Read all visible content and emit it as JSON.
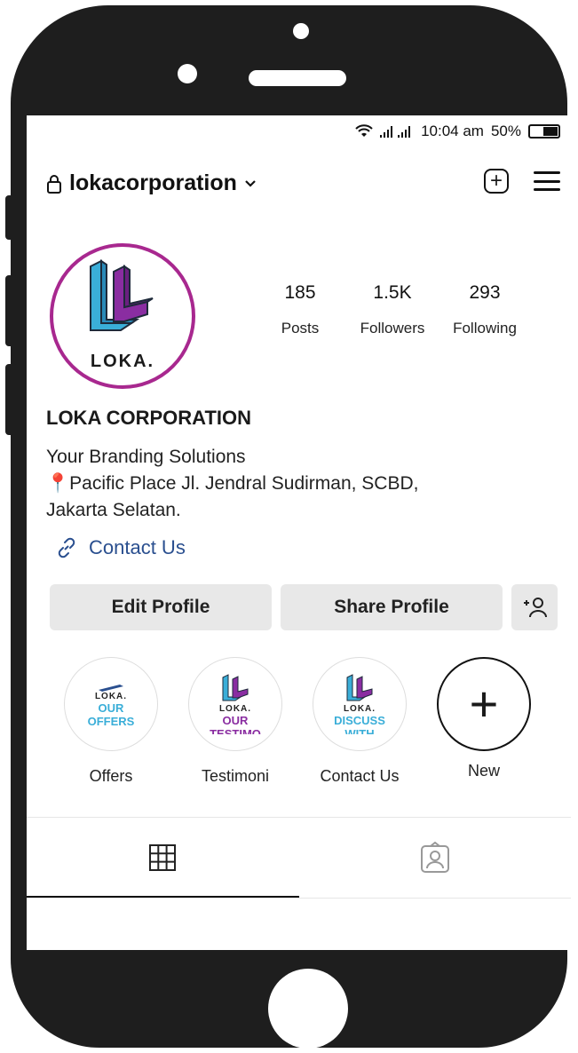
{
  "status_bar": {
    "time": "10:04 am",
    "battery": "50%",
    "battery_level": 0.5
  },
  "header": {
    "username": "lokacorporation"
  },
  "profile": {
    "avatar_text": "LOKA.",
    "stats": [
      {
        "value": "185",
        "label": "Posts"
      },
      {
        "value": "1.5K",
        "label": "Followers"
      },
      {
        "value": "293",
        "label": "Following"
      }
    ],
    "display_name": "LOKA CORPORATION",
    "bio_line1": "Your Branding Solutions",
    "bio_line2": "Pacific Place Jl. Jendral  Sudirman, SCBD,",
    "bio_line3": "Jakarta Selatan.",
    "link": "Contact Us"
  },
  "buttons": {
    "edit": "Edit Profile",
    "share": "Share Profile"
  },
  "highlights": [
    {
      "label": "Offers",
      "cover_brand": "LOKA.",
      "cover_line1": "OUR",
      "cover_line2": "OFFERS"
    },
    {
      "label": "Testimoni",
      "cover_brand": "LOKA.",
      "cover_line1": "OUR",
      "cover_line2": "TESTIMO"
    },
    {
      "label": "Contact Us",
      "cover_brand": "LOKA.",
      "cover_line1": "DISCUSS",
      "cover_line2": "WITH"
    },
    {
      "label": "New",
      "symbol": "+"
    }
  ],
  "colors": {
    "brand_purple": "#8a2da1",
    "brand_cyan": "#3aaed8",
    "avatar_ring": "#a8288f",
    "link_blue": "#2a4f8f"
  },
  "icons": [
    "lock-icon",
    "chevron-down-icon",
    "plus-square-icon",
    "menu-icon",
    "location-pin-icon",
    "link-icon",
    "add-user-icon",
    "grid-icon",
    "tagged-icon"
  ]
}
